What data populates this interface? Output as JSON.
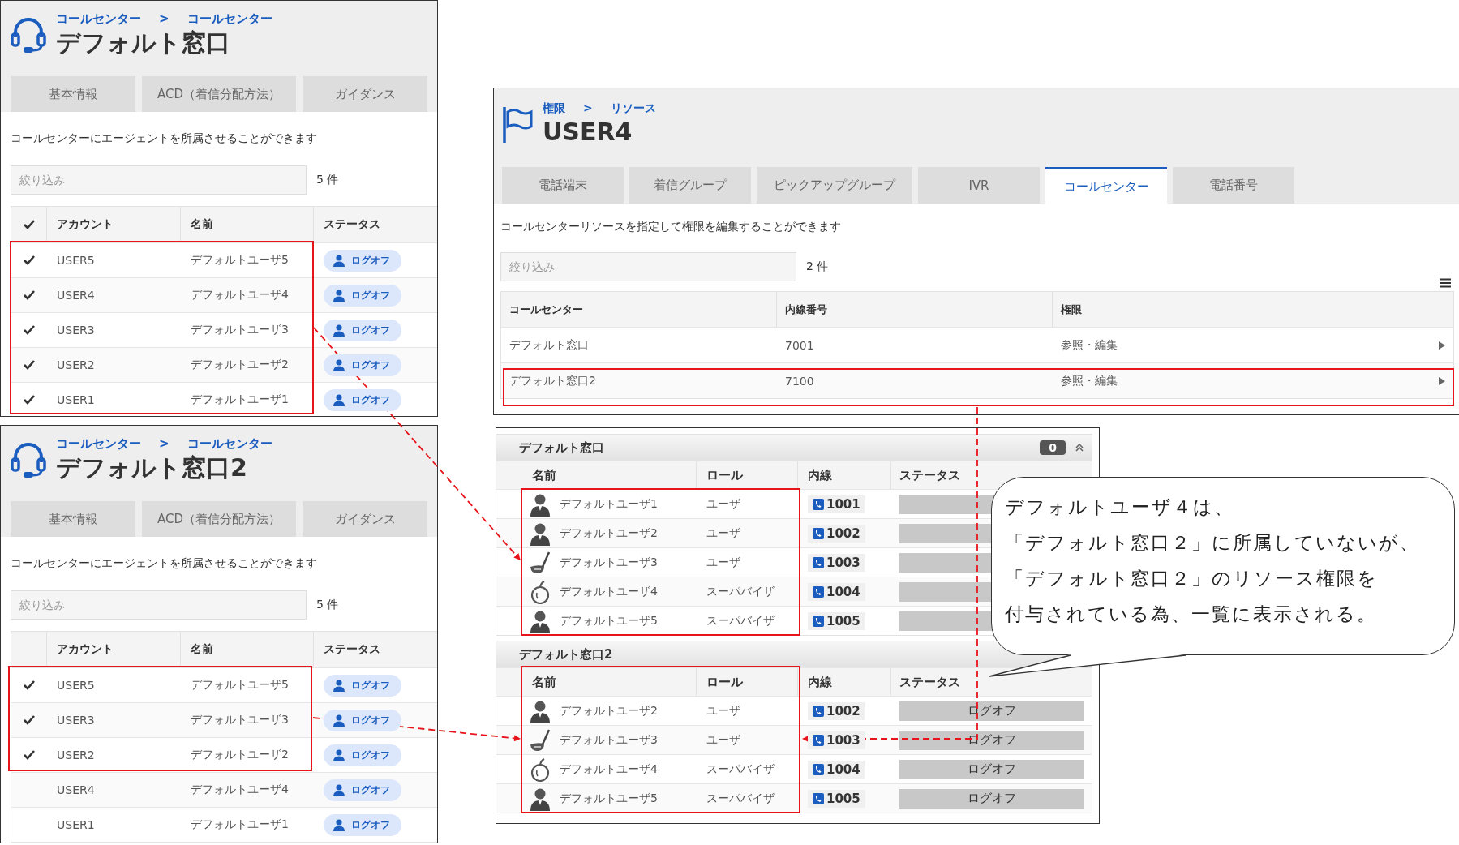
{
  "call_center_panels": [
    {
      "breadcrumb": [
        "コールセンター",
        "コールセンター"
      ],
      "separator": ">",
      "title": "デフォルト窓口",
      "tabs": [
        {
          "label": "基本情報",
          "selected": false
        },
        {
          "label": "ACD（着信分配方法）",
          "selected": false
        },
        {
          "label": "ガイダンス",
          "selected": false
        }
      ],
      "description": "コールセンターにエージェントを所属させることができます",
      "filter": {
        "placeholder": "絞り込み"
      },
      "count": "5 件",
      "table": {
        "select_all_checked": true,
        "columns": [
          "アカウント",
          "名前",
          "ステータス"
        ],
        "rows": [
          {
            "checked": true,
            "account": "USER5",
            "name": "デフォルトユーザ5",
            "status": "ログオフ"
          },
          {
            "checked": true,
            "account": "USER4",
            "name": "デフォルトユーザ4",
            "status": "ログオフ"
          },
          {
            "checked": true,
            "account": "USER3",
            "name": "デフォルトユーザ3",
            "status": "ログオフ"
          },
          {
            "checked": true,
            "account": "USER2",
            "name": "デフォルトユーザ2",
            "status": "ログオフ"
          },
          {
            "checked": true,
            "account": "USER1",
            "name": "デフォルトユーザ1",
            "status": "ログオフ"
          }
        ]
      }
    },
    {
      "breadcrumb": [
        "コールセンター",
        "コールセンター"
      ],
      "separator": ">",
      "title": "デフォルト窓口2",
      "tabs": [
        {
          "label": "基本情報",
          "selected": false
        },
        {
          "label": "ACD（着信分配方法）",
          "selected": false
        },
        {
          "label": "ガイダンス",
          "selected": false
        }
      ],
      "description": "コールセンターにエージェントを所属させることができます",
      "filter": {
        "placeholder": "絞り込み"
      },
      "count": "5 件",
      "table": {
        "select_all_checked": false,
        "columns": [
          "アカウント",
          "名前",
          "ステータス"
        ],
        "rows": [
          {
            "checked": true,
            "account": "USER5",
            "name": "デフォルトユーザ5",
            "status": "ログオフ"
          },
          {
            "checked": true,
            "account": "USER3",
            "name": "デフォルトユーザ3",
            "status": "ログオフ"
          },
          {
            "checked": true,
            "account": "USER2",
            "name": "デフォルトユーザ2",
            "status": "ログオフ"
          },
          {
            "checked": false,
            "account": "USER4",
            "name": "デフォルトユーザ4",
            "status": "ログオフ"
          },
          {
            "checked": false,
            "account": "USER1",
            "name": "デフォルトユーザ1",
            "status": "ログオフ"
          }
        ]
      }
    }
  ],
  "resource_panel": {
    "breadcrumb": [
      "権限",
      "リソース"
    ],
    "separator": ">",
    "title": "USER4",
    "tabs": [
      {
        "label": "電話端末",
        "selected": false
      },
      {
        "label": "着信グループ",
        "selected": false
      },
      {
        "label": "ピックアップグループ",
        "selected": false
      },
      {
        "label": "IVR",
        "selected": false
      },
      {
        "label": "コールセンター",
        "selected": true
      },
      {
        "label": "電話番号",
        "selected": false
      }
    ],
    "description": "コールセンターリソースを指定して権限を編集することができます",
    "filter": {
      "placeholder": "絞り込み"
    },
    "count": "2 件",
    "table": {
      "columns": [
        "コールセンター",
        "内線番号",
        "権限"
      ],
      "rows": [
        {
          "call_center": "デフォルト窓口",
          "extension": "7001",
          "permission": "参照・編集"
        },
        {
          "call_center": "デフォルト窓口2",
          "extension": "7100",
          "permission": "参照・編集"
        }
      ]
    }
  },
  "members_panel": {
    "groups": [
      {
        "name": "デフォルト窓口",
        "badge": "0",
        "columns": [
          "名前",
          "ロール",
          "内線",
          "ステータス"
        ],
        "members": [
          {
            "kind": "person",
            "name": "デフォルトユーザ1",
            "role": "ユーザ",
            "extension": "1001"
          },
          {
            "kind": "person",
            "name": "デフォルトユーザ2",
            "role": "ユーザ",
            "extension": "1002"
          },
          {
            "kind": "golf",
            "name": "デフォルトユーザ3",
            "role": "ユーザ",
            "extension": "1003"
          },
          {
            "kind": "apple",
            "name": "デフォルトユーザ4",
            "role": "スーパバイザ",
            "extension": "1004"
          },
          {
            "kind": "person",
            "name": "デフォルトユーザ5",
            "role": "スーパバイザ",
            "extension": "1005"
          }
        ]
      },
      {
        "name": "デフォルト窓口2",
        "columns": [
          "名前",
          "ロール",
          "内線",
          "ステータス"
        ],
        "members": [
          {
            "kind": "person",
            "name": "デフォルトユーザ2",
            "role": "ユーザ",
            "extension": "1002",
            "status": "ログオフ"
          },
          {
            "kind": "golf",
            "name": "デフォルトユーザ3",
            "role": "ユーザ",
            "extension": "1003",
            "status": "ログオフ"
          },
          {
            "kind": "apple",
            "name": "デフォルトユーザ4",
            "role": "スーパバイザ",
            "extension": "1004",
            "status": "ログオフ"
          },
          {
            "kind": "person",
            "name": "デフォルトユーザ5",
            "role": "スーパバイザ",
            "extension": "1005",
            "status": "ログオフ"
          }
        ]
      }
    ]
  },
  "callout": {
    "lines": [
      "デフォルトユーザ４は、",
      "「デフォルト窓口２」に所属していないが、",
      "「デフォルト窓口２」のリソース権限を",
      "付与されている為、一覧に表示される。"
    ]
  }
}
